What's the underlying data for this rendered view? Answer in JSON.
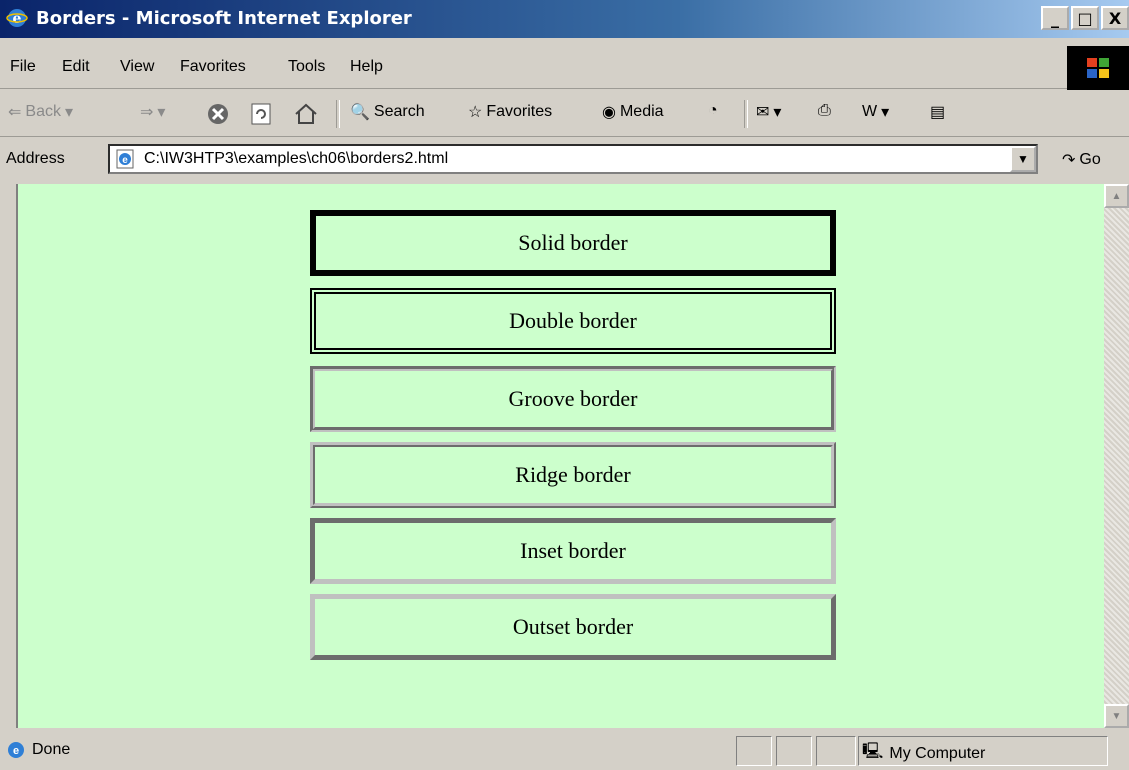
{
  "window": {
    "title": "Borders - Microsoft Internet Explorer",
    "background_text": "borders2.html",
    "buttons": {
      "minimize": "_",
      "maximize": "□",
      "close": "X"
    }
  },
  "menu": [
    "File",
    "Edit",
    "View",
    "Favorites",
    "Tools",
    "Help"
  ],
  "toolbar": {
    "back": "Back",
    "search": "Search",
    "favorites": "Favorites",
    "media": "Media"
  },
  "address": {
    "label": "Address",
    "url": "C:\\IW3HTP3\\examples\\ch06\\borders2.html",
    "go": "Go"
  },
  "boxes": [
    {
      "label": "Solid border",
      "style": "solid"
    },
    {
      "label": "Double border",
      "style": "double"
    },
    {
      "label": "Groove border",
      "style": "groove"
    },
    {
      "label": "Ridge border",
      "style": "ridge"
    },
    {
      "label": "Inset border",
      "style": "inset"
    },
    {
      "label": "Outset border",
      "style": "outset"
    }
  ],
  "status": {
    "text": "Done",
    "zone": "My Computer"
  },
  "colors": {
    "page_background": "#ccffcc",
    "titlebar_start": "#0a246a",
    "chrome": "#d4d0c8"
  }
}
